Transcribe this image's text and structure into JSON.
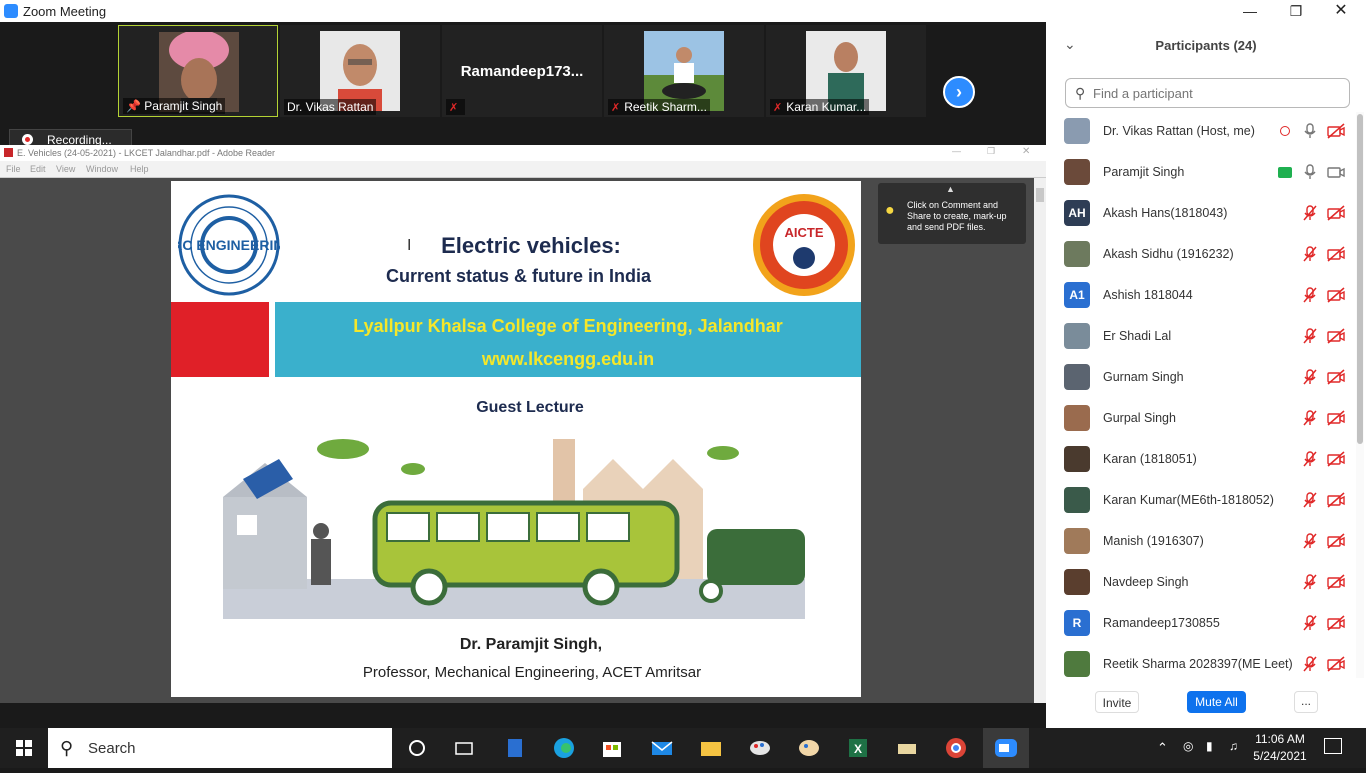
{
  "window": {
    "title": "Zoom Meeting"
  },
  "video_tiles": [
    {
      "name": "Paramjit Singh",
      "mic": "pinned"
    },
    {
      "name": "Dr. Vikas Rattan",
      "mic": "on"
    },
    {
      "name": "Ramandeep173...",
      "mic": "off",
      "big": true
    },
    {
      "name": "Reetik Sharm...",
      "mic": "off"
    },
    {
      "name": "Karan Kumar...",
      "mic": "off"
    }
  ],
  "recording": {
    "label": "Recording..."
  },
  "reader": {
    "title": "E. Vehicles (24-05-2021) - LKCET Jalandhar.pdf - Adobe Reader",
    "menu": [
      "File",
      "Edit",
      "View",
      "Window",
      "Help"
    ],
    "tooltip": "Click on Comment and Share to create, mark-up and send PDF files."
  },
  "slide": {
    "title_line1": "Electric vehicles:",
    "title_line2": "Current status & future in India",
    "college": "Lyallpur Khalsa College of Engineering, Jalandhar",
    "website": "www.lkcengg.edu.in",
    "subtitle": "Guest Lecture",
    "author": "Dr. Paramjit Singh,",
    "role": "Professor, Mechanical Engineering, ACET Amritsar",
    "logo_left": "LKC ENGINEERING",
    "logo_right": "AICTE"
  },
  "panel": {
    "title": "Participants (24)",
    "search_placeholder": "Find a participant",
    "participants": [
      {
        "name": "Dr. Vikas Rattan (Host, me)",
        "avatar": "photo",
        "color": "#8a9bb0"
      },
      {
        "name": "Paramjit Singh",
        "avatar": "photo",
        "color": "#6b4a3a"
      },
      {
        "name": "Akash Hans(1818043)",
        "avatar": "AH",
        "color": "#2e3d55"
      },
      {
        "name": "Akash Sidhu (1916232)",
        "avatar": "photo",
        "color": "#6d7a5e"
      },
      {
        "name": "Ashish 1818044",
        "avatar": "A1",
        "color": "#2a6fd1"
      },
      {
        "name": "Er Shadi Lal",
        "avatar": "photo",
        "color": "#7a8c9a"
      },
      {
        "name": "Gurnam Singh",
        "avatar": "photo",
        "color": "#5b6470"
      },
      {
        "name": "Gurpal Singh",
        "avatar": "photo",
        "color": "#9a6b4e"
      },
      {
        "name": "Karan (1818051)",
        "avatar": "photo",
        "color": "#4a3a2e"
      },
      {
        "name": "Karan Kumar(ME6th-1818052)",
        "avatar": "photo",
        "color": "#3a5a4a"
      },
      {
        "name": "Manish (1916307)",
        "avatar": "photo",
        "color": "#a07a5a"
      },
      {
        "name": "Navdeep Singh",
        "avatar": "photo",
        "color": "#5a3e2e"
      },
      {
        "name": "Ramandeep1730855",
        "avatar": "R",
        "color": "#2a6fd1"
      },
      {
        "name": "Reetik Sharma 2028397(ME Leet)",
        "avatar": "photo",
        "color": "#4f7a3e"
      }
    ],
    "invite": "Invite",
    "mute_all": "Mute All",
    "more": "..."
  },
  "taskbar": {
    "search": "Search",
    "time": "11:06 AM",
    "date": "5/24/2021"
  },
  "colors": {
    "zoom_blue": "#2d8cff",
    "mute_red": "#e02828"
  }
}
